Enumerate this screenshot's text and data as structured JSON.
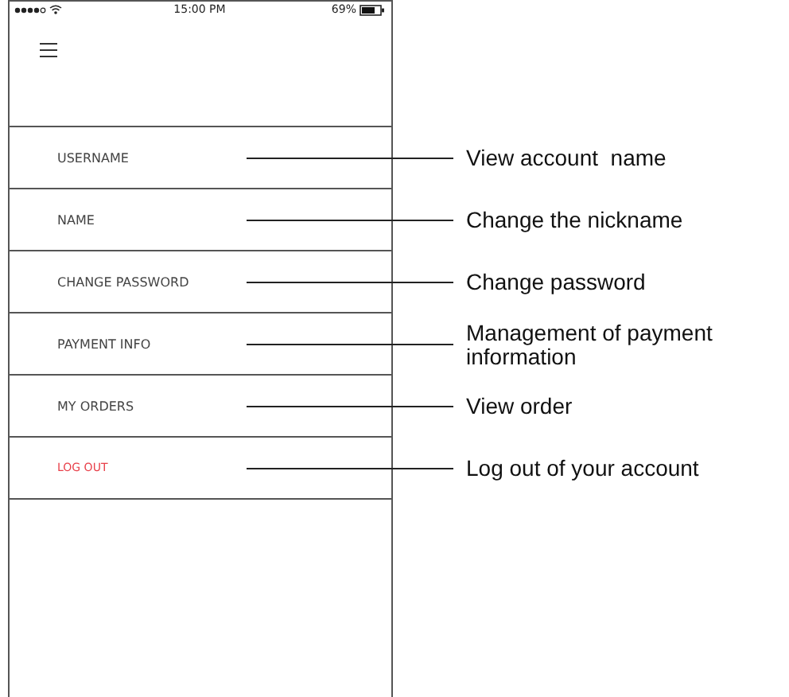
{
  "status_bar": {
    "time": "15:00 PM",
    "battery": "69%"
  },
  "menu_items": [
    {
      "label": "USERNAME",
      "kind": "item",
      "annotation": "View account  name"
    },
    {
      "label": "NAME",
      "kind": "item",
      "annotation": "Change the nickname"
    },
    {
      "label": "CHANGE PASSWORD",
      "kind": "item",
      "annotation": "Change password"
    },
    {
      "label": "PAYMENT INFO",
      "kind": "item",
      "annotation": "Management of payment information"
    },
    {
      "label": "MY ORDERS",
      "kind": "item",
      "annotation": "View order"
    },
    {
      "label": "LOG OUT",
      "kind": "logout",
      "annotation": "Log out of your account"
    }
  ]
}
